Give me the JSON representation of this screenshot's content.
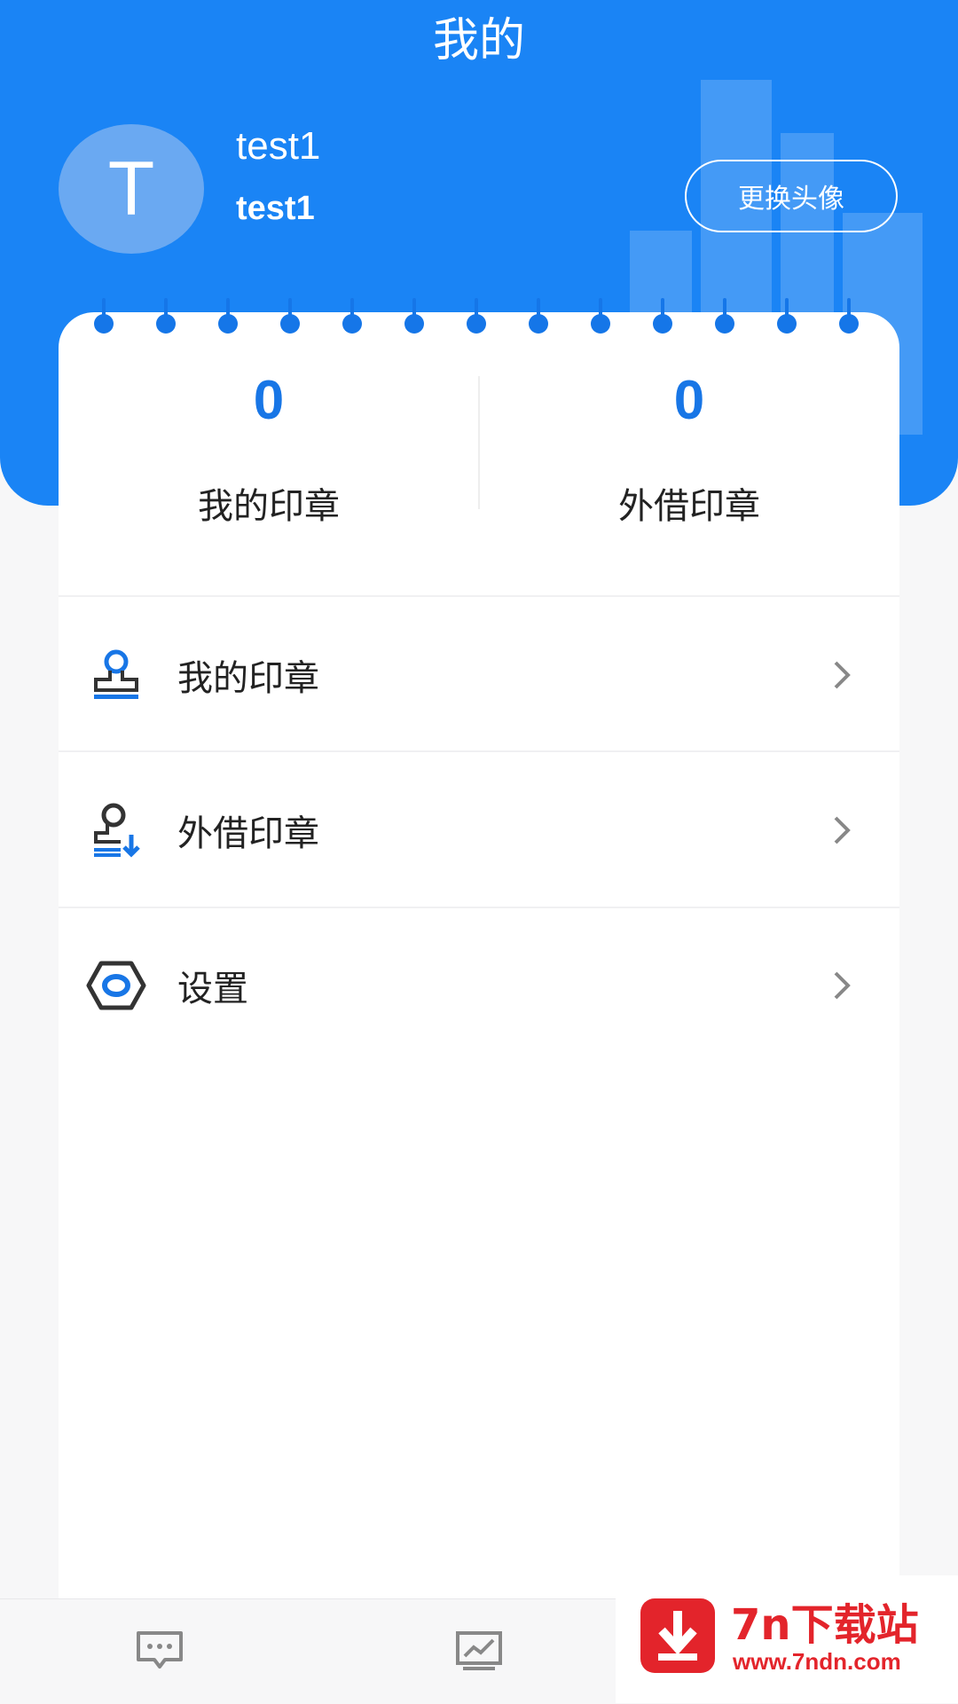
{
  "header": {
    "title": "我的",
    "avatar_letter": "T",
    "username": "test1",
    "account": "test1",
    "change_avatar_label": "更换头像"
  },
  "stats": [
    {
      "value": "0",
      "label": "我的印章"
    },
    {
      "value": "0",
      "label": "外借印章"
    }
  ],
  "menu": [
    {
      "label": "我的印章",
      "icon": "stamp-icon"
    },
    {
      "label": "外借印章",
      "icon": "stamp-borrow-icon"
    },
    {
      "label": "设置",
      "icon": "settings-icon"
    }
  ],
  "tabbar": {
    "icons": [
      "message-icon",
      "chart-icon"
    ]
  },
  "watermark": {
    "title": "7n下载站",
    "url": "www.7ndn.com"
  },
  "colors": {
    "primary": "#1a84f5",
    "accent": "#1876e6",
    "watermark": "#e3242b"
  }
}
